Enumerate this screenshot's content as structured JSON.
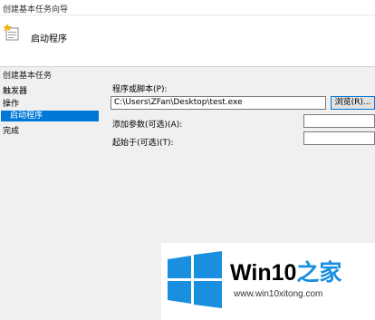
{
  "window": {
    "title": "创建基本任务向导"
  },
  "header": {
    "title": "启动程序"
  },
  "sidebar": {
    "heading": "创建基本任务",
    "items": [
      {
        "label": "触发器"
      },
      {
        "label": "操作"
      },
      {
        "label": "启动程序"
      },
      {
        "label": "完成"
      }
    ]
  },
  "form": {
    "program_label": "程序或脚本(P):",
    "program_value": "C:\\Users\\ZFan\\Desktop\\test.exe",
    "browse_label": "浏览(R)...",
    "args_label": "添加参数(可选)(A):",
    "args_value": "",
    "startin_label": "起始于(可选)(T):",
    "startin_value": ""
  },
  "watermark": {
    "brand": "Win10",
    "brand_accent": "之家",
    "url": "www.win10xitong.com"
  },
  "colors": {
    "selection": "#0078d7",
    "brand_blue": "#1a8fe0"
  }
}
